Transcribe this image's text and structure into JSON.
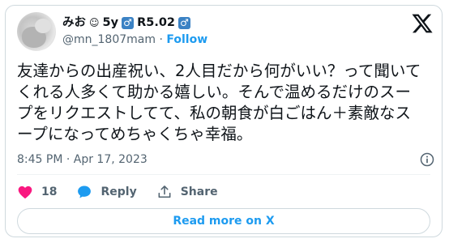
{
  "user": {
    "display_name": "みお",
    "emoji": "☺",
    "badge1_text": "5y",
    "badge2_text": "R5.02",
    "male_symbol": "♂",
    "handle": "@mn_1807mam",
    "separator": "·",
    "follow_label": "Follow"
  },
  "tweet": {
    "text": "友達からの出産祝い、2人目だから何がいい？って聞いて\nくれる人多くて助かる嬉しい。そんで温めるだけのスー\nプをリクエストしてて、私の朝食が白ごはん＋素敵なス\nープになってめちゃくちゃ幸福。",
    "timestamp": "8:45 PM · Apr 17, 2023"
  },
  "actions": {
    "like_count": "18",
    "reply_label": "Reply",
    "share_label": "Share"
  },
  "read_more_label": "Read more on X",
  "colors": {
    "accent": "#1d9bf0",
    "like": "#f91880",
    "text": "#0f1419",
    "muted": "#536471",
    "male_badge": "#3b82c4"
  },
  "icons": {
    "logo": "x-logo-icon",
    "info": "info-icon",
    "like": "heart-icon",
    "reply": "speech-bubble-icon",
    "share": "share-icon"
  }
}
